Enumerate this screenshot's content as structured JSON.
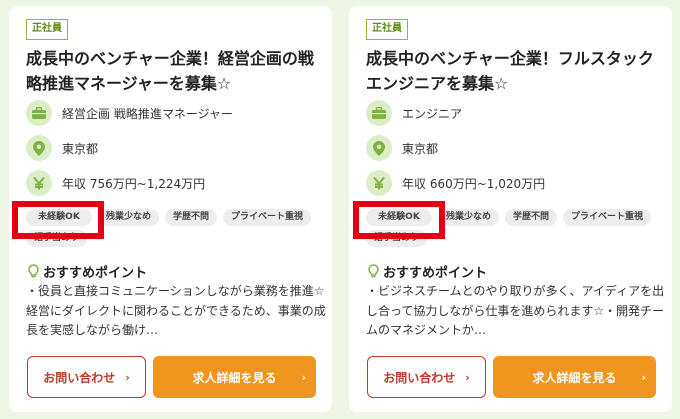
{
  "colors": {
    "accent_green": "#8bbd3a",
    "orange": "#f0961e",
    "contact_red": "#c0392b",
    "highlight_red": "#e50012"
  },
  "cards": [
    {
      "employment_badge": "正社員",
      "title": "成長中のベンチャー企業！経営企画の戦略推進マネージャーを募集☆",
      "job_type": "経営企画 戦略推進マネージャー",
      "location": "東京都",
      "salary": "年収 756万円~1,224万円",
      "tags": [
        "未経験OK",
        "残業少なめ",
        "学歴不問",
        "プライベート重視",
        "語手当あり"
      ],
      "point_heading": "おすすめポイント",
      "point_text": "・役員と直接コミュニケーションしながら業務を推進☆経営にダイレクトに関わることができるため、事業の成長を実感しながら働け…",
      "contact_button": "お問い合わせ",
      "detail_button": "求人詳細を見る"
    },
    {
      "employment_badge": "正社員",
      "title": "成長中のベンチャー企業！フルスタックエンジニアを募集☆",
      "job_type": "エンジニア",
      "location": "東京都",
      "salary": "年収 660万円~1,020万円",
      "tags": [
        "未経験OK",
        "残業少なめ",
        "学歴不問",
        "プライベート重視",
        "語手当あり"
      ],
      "point_heading": "おすすめポイント",
      "point_text": "・ビジネスチームとのやり取りが多く、アイディアを出し合って協力しながら仕事を進められます☆・開発チームのマネジメントか…",
      "contact_button": "お問い合わせ",
      "detail_button": "求人詳細を見る"
    }
  ],
  "icons": {
    "job": "briefcase-icon",
    "location": "map-pin-icon",
    "salary": "yen-icon",
    "point": "lightbulb-icon",
    "arrow": "chevron-right-icon"
  }
}
